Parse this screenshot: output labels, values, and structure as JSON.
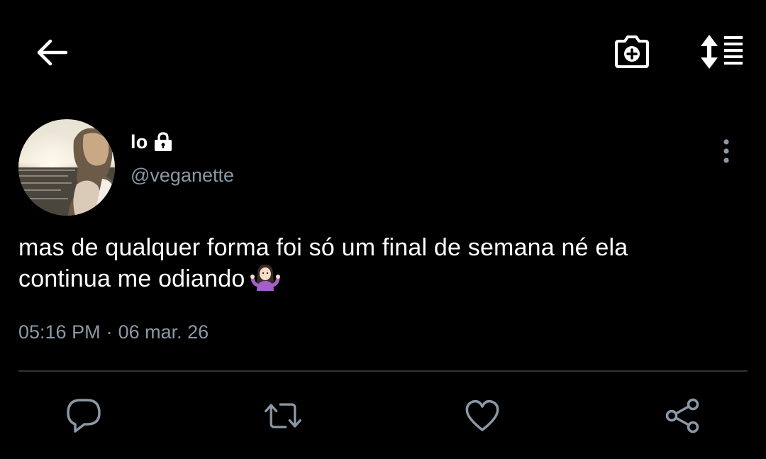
{
  "tweet": {
    "author": {
      "display_name": "lo",
      "handle": "@veganette",
      "protected": true
    },
    "text_line1": "mas de qualquer forma foi só um final de semana né ela",
    "text_line2": "continua me odiando",
    "time": "05:16 PM",
    "separator": "·",
    "date": "06 mar. 26"
  },
  "icons": {
    "back": "back-arrow-icon",
    "camera": "camera-add-icon",
    "sort": "sort-list-icon",
    "lock": "lock-icon",
    "more": "more-vertical-icon",
    "emoji": "person-shrugging-emoji",
    "reply": "reply-icon",
    "retweet": "retweet-icon",
    "like": "heart-icon",
    "share": "share-icon"
  },
  "colors": {
    "background": "#000000",
    "text_primary": "#ffffff",
    "text_secondary": "#8b98a5",
    "divider": "#2f3336"
  }
}
